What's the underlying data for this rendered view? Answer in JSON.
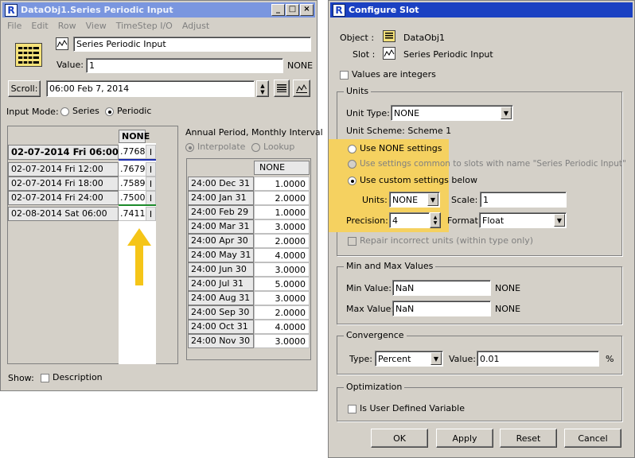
{
  "left": {
    "title": "DataObj1.Series Periodic Input",
    "menu": [
      "File",
      "Edit",
      "Row",
      "View",
      "TimeStep I/O",
      "Adjust"
    ],
    "slot_name": "Series Periodic Input",
    "value_label": "Value:",
    "value": "1",
    "value_unit": "NONE",
    "scroll_label": "Scroll:",
    "scroll_date": "06:00 Feb 7, 2014",
    "input_mode_label": "Input Mode:",
    "mode_series": "Series",
    "mode_periodic": "Periodic",
    "series_header": "NONE",
    "series_rows": [
      {
        "date": "02-07-2014 Fri 06:00",
        "value": ".7768",
        "flag": "I"
      },
      {
        "date": "02-07-2014 Fri 12:00",
        "value": ".7679",
        "flag": "I"
      },
      {
        "date": "02-07-2014 Fri 18:00",
        "value": ".7589",
        "flag": "I"
      },
      {
        "date": "02-07-2014 Fri 24:00",
        "value": ".7500",
        "flag": "I"
      },
      {
        "date": "02-08-2014 Sat 06:00",
        "value": ".7411",
        "flag": "I"
      }
    ],
    "periodic_caption": "Annual Period, Monthly Interval",
    "interpolate": "Interpolate",
    "lookup": "Lookup",
    "periodic_header": "NONE",
    "periodic_rows": [
      {
        "date": "24:00 Dec 31",
        "value": "1.0000"
      },
      {
        "date": "24:00 Jan 31",
        "value": "2.0000"
      },
      {
        "date": "24:00 Feb 29",
        "value": "1.0000"
      },
      {
        "date": "24:00 Mar 31",
        "value": "3.0000"
      },
      {
        "date": "24:00 Apr 30",
        "value": "2.0000"
      },
      {
        "date": "24:00 May 31",
        "value": "4.0000"
      },
      {
        "date": "24:00 Jun 30",
        "value": "3.0000"
      },
      {
        "date": "24:00 Jul 31",
        "value": "5.0000"
      },
      {
        "date": "24:00 Aug 31",
        "value": "3.0000"
      },
      {
        "date": "24:00 Sep 30",
        "value": "2.0000"
      },
      {
        "date": "24:00 Oct 31",
        "value": "4.0000"
      },
      {
        "date": "24:00 Nov 30",
        "value": "3.0000"
      }
    ],
    "show_label": "Show:",
    "description": "Description"
  },
  "right": {
    "title": "Configure Slot",
    "object_label": "Object :",
    "object_value": "DataObj1",
    "slot_label": "Slot :",
    "slot_value": "Series Periodic Input",
    "values_integers": "Values are integers",
    "units_group": "Units",
    "unit_type_label": "Unit Type:",
    "unit_type_value": "NONE",
    "unit_scheme": "Unit Scheme: Scheme 1",
    "use_none": "Use NONE settings",
    "use_common": "Use settings common to slots with name \"Series Periodic Input\"",
    "use_custom": "Use custom settings below",
    "units_label": "Units:",
    "units_value": "NONE",
    "scale_label": "Scale:",
    "scale_value": "1",
    "precision_label": "Precision:",
    "precision_value": "4",
    "format_label": "Format",
    "format_value": "Float",
    "repair": "Repair incorrect units (within type only)",
    "minmax_group": "Min and Max Values",
    "min_label": "Min Value:",
    "min_value": "NaN",
    "min_unit": "NONE",
    "max_label": "Max Value:",
    "max_value": "NaN",
    "max_unit": "NONE",
    "conv_group": "Convergence",
    "type_label": "Type:",
    "type_value": "Percent",
    "conv_value_label": "Value:",
    "conv_value": "0.01",
    "conv_unit": "%",
    "opt_group": "Optimization",
    "user_defined": "Is User Defined Variable",
    "ok": "OK",
    "apply": "Apply",
    "reset": "Reset",
    "cancel": "Cancel"
  },
  "colors": {
    "highlight": "#f5d160",
    "arrow": "#f5c518",
    "active_title": "#1b41c2",
    "inactive_title": "#7a96df"
  }
}
